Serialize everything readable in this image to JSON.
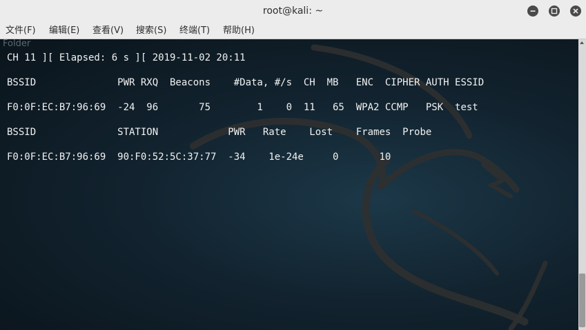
{
  "window": {
    "title": "root@kali: ~"
  },
  "menu": [
    "文件(F)",
    "编辑(E)",
    "查看(V)",
    "搜索(S)",
    "终端(T)",
    "帮助(H)"
  ],
  "terminal": {
    "ghost_label": "Folder",
    "lines": [
      "CH 11 ][ Elapsed: 6 s ][ 2019-11-02 20:11",
      "BSSID              PWR RXQ  Beacons    #Data, #/s  CH  MB   ENC  CIPHER AUTH ESSID",
      "F0:0F:EC:B7:96:69  -24  96       75        1    0  11   65  WPA2 CCMP   PSK  test",
      "BSSID              STATION            PWR   Rate    Lost    Frames  Probe",
      "F0:0F:EC:B7:96:69  90:F0:52:5C:37:77  -34    1e-24e     0       10"
    ]
  }
}
